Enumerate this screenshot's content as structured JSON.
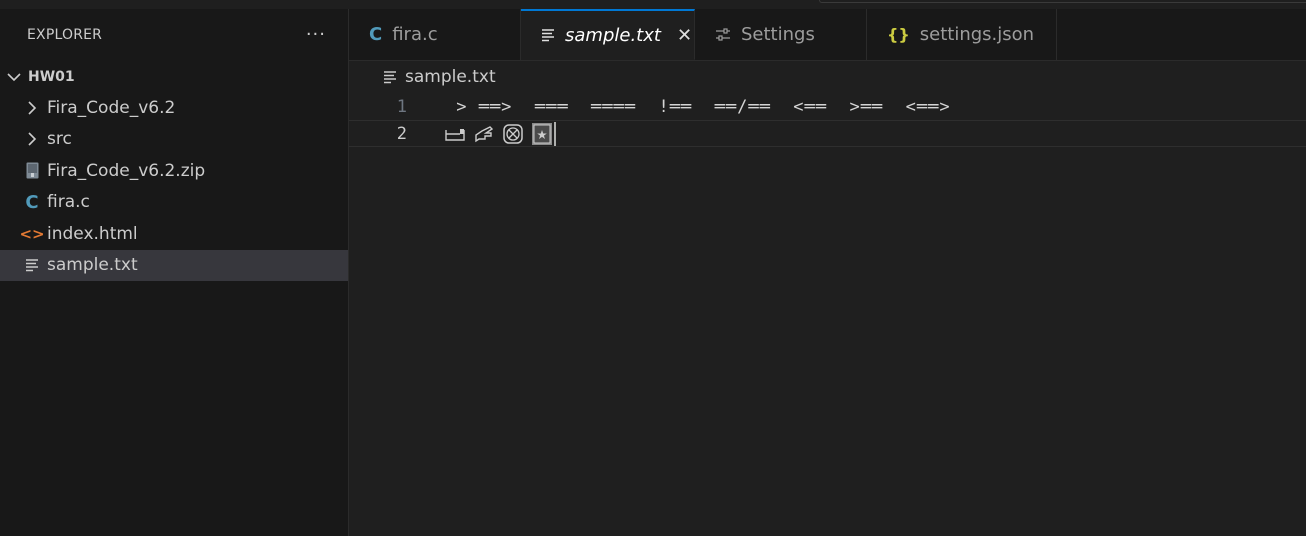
{
  "sidebar": {
    "title": "EXPLORER",
    "more": "···",
    "root": "HW01",
    "items": [
      {
        "label": "Fira_Code_v6.2",
        "icon": "chevron-right-icon"
      },
      {
        "label": "src",
        "icon": "chevron-right-icon"
      },
      {
        "label": "Fira_Code_v6.2.zip",
        "icon": "zip-file-icon"
      },
      {
        "label": "fira.c",
        "icon": "c-file-icon"
      },
      {
        "label": "index.html",
        "icon": "html-file-icon"
      },
      {
        "label": "sample.txt",
        "icon": "text-file-icon",
        "selected": true
      }
    ]
  },
  "tabs": [
    {
      "label": "fira.c",
      "icon": "c-file-icon"
    },
    {
      "label": "sample.txt",
      "icon": "text-file-icon",
      "active": true,
      "close": "✕"
    },
    {
      "label": "Settings",
      "icon": "settings-sliders-icon"
    },
    {
      "label": "settings.json",
      "icon": "json-braces-icon"
    }
  ],
  "breadcrumb": {
    "file": "sample.txt"
  },
  "editor": {
    "lines": [
      {
        "number": "1",
        "text": " > ══>  ═══  ════  !══  ══/══  <══  >══  <══>"
      },
      {
        "number": "2",
        "text": ""
      }
    ]
  },
  "colors": {
    "accent": "#0078d4",
    "c_icon": "#519aba",
    "html_icon": "#e37933",
    "json_icon": "#cbcb41"
  }
}
